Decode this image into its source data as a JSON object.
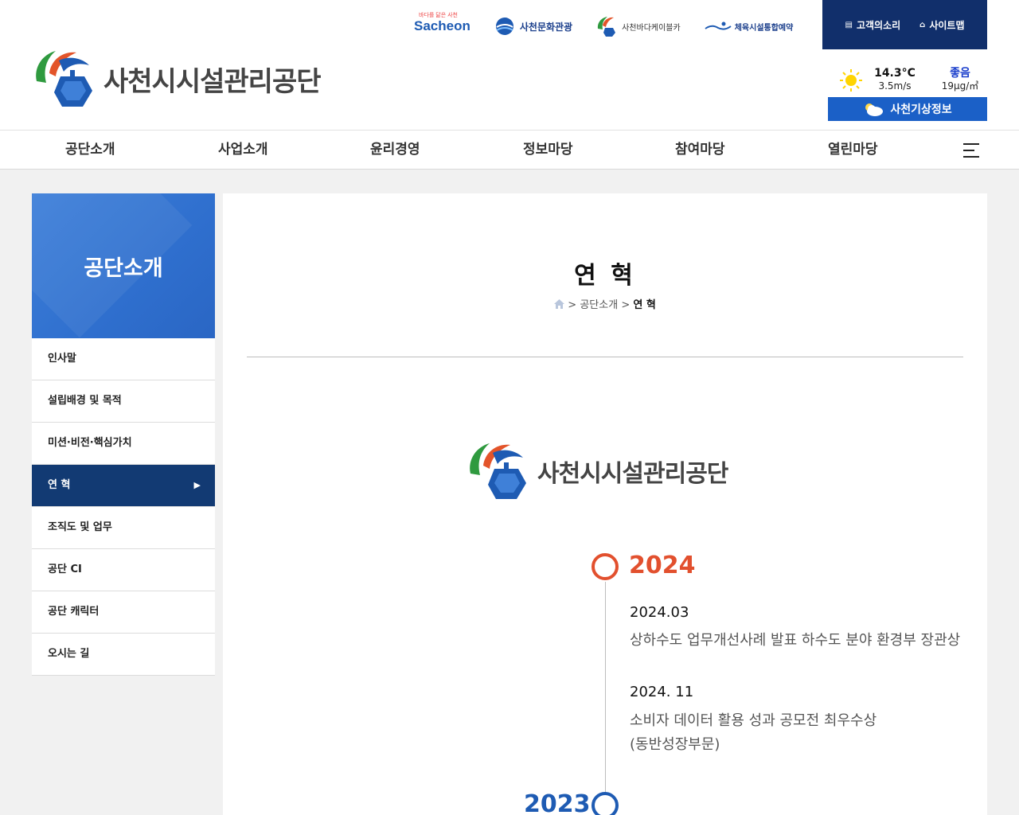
{
  "header": {
    "logo_text": "사천시시설관리공단",
    "partners": {
      "sachecon_tagline": "바다를 닮은 사천",
      "sachecon": "Sacheon",
      "culture": "사천문화관광",
      "cable": "사천바다케이블카",
      "sports": "체육시설통합예약"
    },
    "util": {
      "voice": "고객의소리",
      "sitemap": "사이트맵"
    },
    "weather": {
      "temp": "14.3°C",
      "wind": "3.5m/s",
      "dust_grade": "좋음",
      "dust_value": "19μg/㎥",
      "button": "사천기상정보"
    }
  },
  "nav": [
    "공단소개",
    "사업소개",
    "윤리경영",
    "정보마당",
    "참여마당",
    "열린마당"
  ],
  "sidebar": {
    "title": "공단소개",
    "items": [
      {
        "label": "인사말"
      },
      {
        "label": "설립배경 및 목적"
      },
      {
        "label": "미션·비전·핵심가치"
      },
      {
        "label": "연 혁"
      },
      {
        "label": "조직도 및 업무"
      },
      {
        "label": "공단 CI"
      },
      {
        "label": "공단 캐릭터"
      },
      {
        "label": "오시는 길"
      }
    ],
    "active_index": 3
  },
  "content": {
    "title": "연 혁",
    "breadcrumb": {
      "sep": ">",
      "level1": "공단소개",
      "current": "연 혁"
    },
    "logo_text": "사천시시설관리공단",
    "timeline": [
      {
        "year": "2024",
        "events": [
          {
            "date": "2024.03",
            "desc": "상하수도 업무개선사례 발표 하수도 분야 환경부 장관상"
          },
          {
            "date": "2024. 11",
            "desc": "소비자 데이터 활용 성과 공모전 최우수상",
            "desc2": "(동반성장부문)"
          }
        ]
      },
      {
        "year": "2023"
      }
    ]
  },
  "colors": {
    "navy": "#123a73",
    "blue": "#1b60c7",
    "year_2024": "#e2502e",
    "year_2023": "#1e5bb3"
  }
}
